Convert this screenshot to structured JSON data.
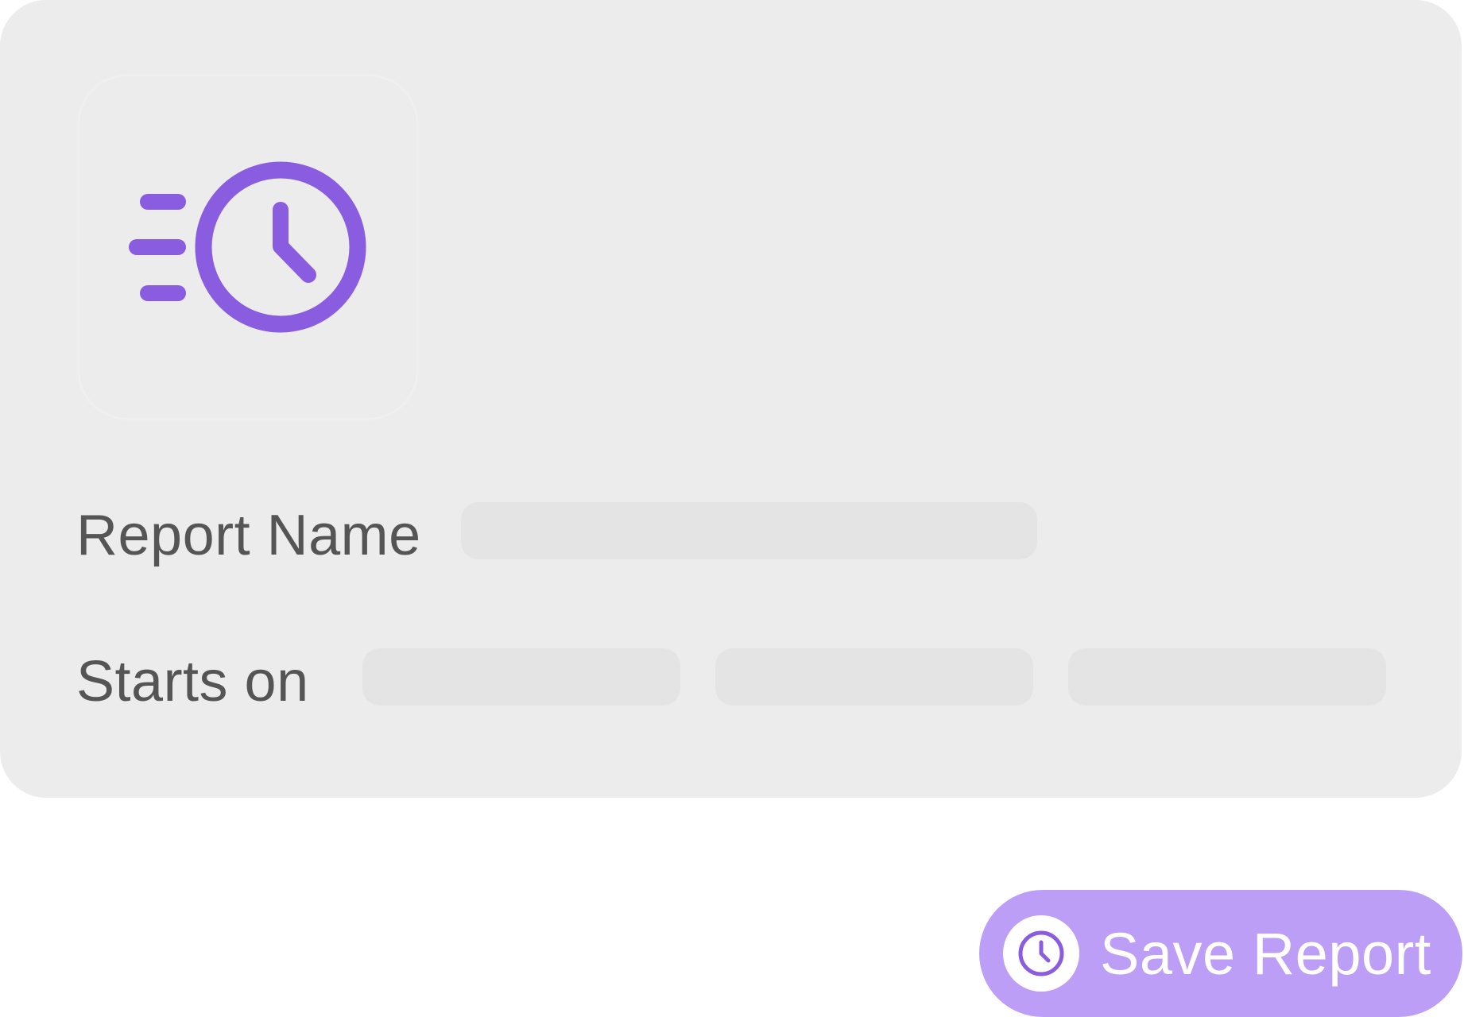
{
  "form": {
    "report_name_label": "Report Name",
    "report_name_value": "",
    "starts_on_label": "Starts on",
    "starts_on_fields": [
      "",
      "",
      ""
    ]
  },
  "save_button": {
    "label": "Save Report",
    "icon": "clock-icon"
  },
  "header_icon": "fast-clock-icon",
  "colors": {
    "accent": "#8a5ce0",
    "button": "#bd9ef6",
    "card": "#ececec",
    "input": "#e4e4e4",
    "label": "#555555"
  }
}
